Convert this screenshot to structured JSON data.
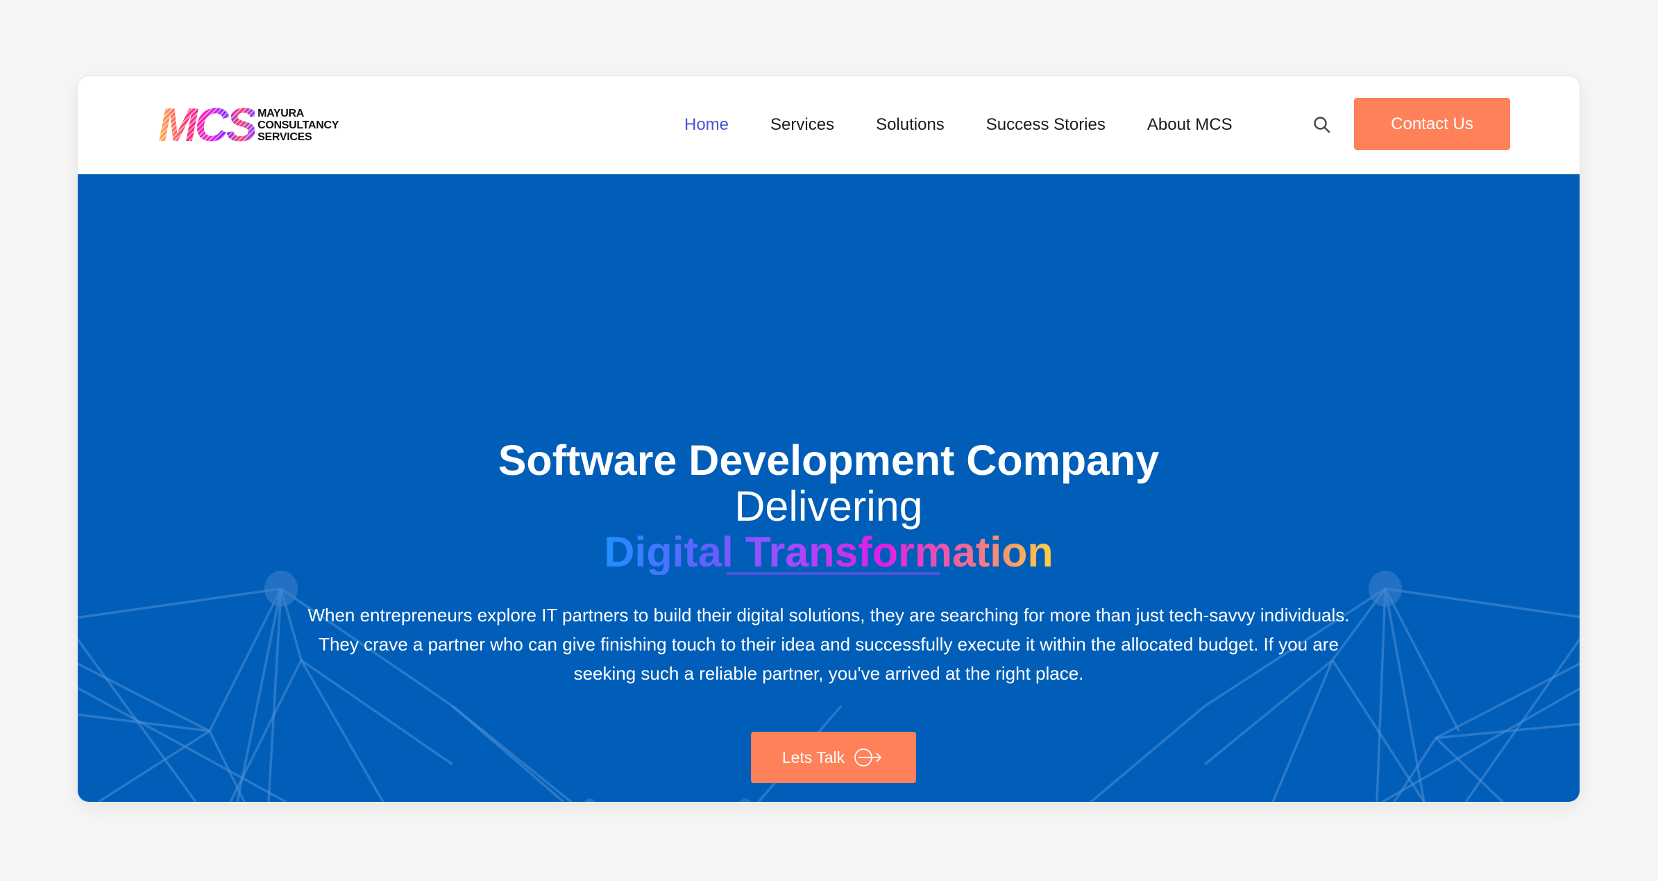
{
  "brand": {
    "logo_mark": "MCS",
    "logo_lines": [
      "Mayura",
      "Consultancy",
      "Services"
    ]
  },
  "nav": {
    "items": [
      {
        "label": "Home",
        "active": true
      },
      {
        "label": "Services",
        "active": false
      },
      {
        "label": "Solutions",
        "active": false
      },
      {
        "label": "Success Stories",
        "active": false
      },
      {
        "label": "About MCS",
        "active": false
      }
    ],
    "search_icon": "search-icon",
    "cta_label": "Contact Us"
  },
  "hero": {
    "title_line1": "Software Development Company",
    "title_line2": "Delivering",
    "title_highlight": "Digital Transformation",
    "description": "When entrepreneurs explore IT partners to build their digital solutions, they are searching for more than just tech-savvy individuals. They crave a partner who can give finishing touch to their idea and successfully execute it within the allocated budget. If you are seeking such a reliable partner, you've arrived at the right place.",
    "cta_label": "Lets Talk",
    "cta_icon": "circle-arrow-right-icon"
  },
  "colors": {
    "page_bg": "#f6f6f6",
    "hero_bg": "#005eb8",
    "accent_orange": "#ff815a",
    "nav_active": "#4a52d8",
    "divider": "#4b55d9"
  }
}
